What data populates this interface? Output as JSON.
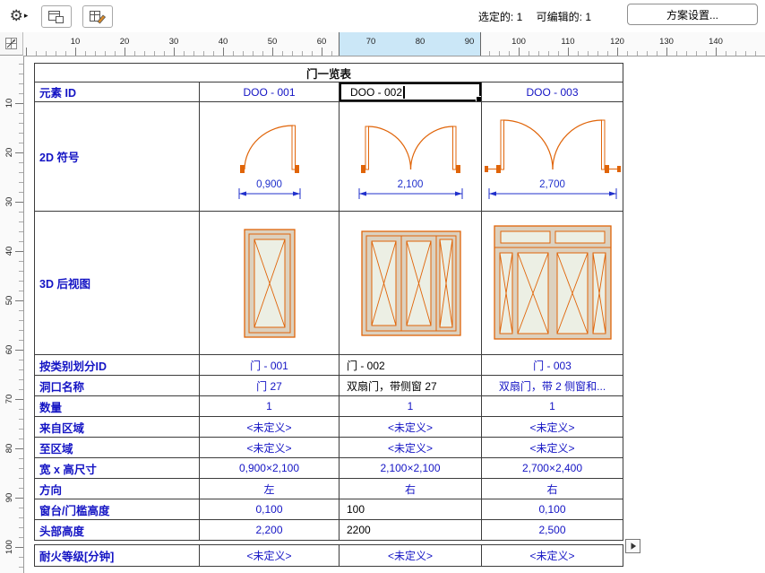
{
  "toolbar": {
    "status": {
      "selected_label": "选定的:",
      "selected_count": "1",
      "editable_label": "可编辑的:",
      "editable_count": "1"
    },
    "scheme_settings_label": "方案设置..."
  },
  "rulers": {
    "horizontal": [
      "10",
      "20",
      "30",
      "40",
      "50",
      "60",
      "70",
      "80",
      "90",
      "100",
      "110",
      "120",
      "130",
      "140"
    ],
    "vertical": [
      "10",
      "20",
      "30",
      "40",
      "50",
      "60",
      "70",
      "80",
      "90",
      "100"
    ]
  },
  "schedule": {
    "title": "门一览表",
    "element_id_row": {
      "label": "元素 ID",
      "values": [
        "DOO - 001",
        "DOO - 002",
        "DOO - 003"
      ]
    },
    "symbol_row_label": "2D 符号",
    "view_row_label": "3D 后视图",
    "dims": [
      "0,900",
      "2,100",
      "2,700"
    ],
    "rows": [
      {
        "label": "按类别划分ID",
        "values": [
          "门 - 001",
          "门 - 002",
          "门 - 003"
        ]
      },
      {
        "label": "洞口名称",
        "values": [
          "门 27",
          "双扇门，带侧窗 27",
          "双扇门，带 2 侧窗和..."
        ]
      },
      {
        "label": "数量",
        "values": [
          "1",
          "1",
          "1"
        ]
      },
      {
        "label": "来自区域",
        "values": [
          "<未定义>",
          "<未定义>",
          "<未定义>"
        ]
      },
      {
        "label": "至区域",
        "values": [
          "<未定义>",
          "<未定义>",
          "<未定义>"
        ]
      },
      {
        "label": "宽 x 高尺寸",
        "values": [
          "0,900×2,100",
          "2,100×2,100",
          "2,700×2,400"
        ]
      },
      {
        "label": "方向",
        "values": [
          "左",
          "右",
          "右"
        ]
      },
      {
        "label": "窗台/门槛高度",
        "values": [
          "0,100",
          "100",
          "0,100"
        ]
      },
      {
        "label": "头部高度",
        "values": [
          "2,200",
          "2200",
          "2,500"
        ]
      },
      {
        "label": "耐火等级[分钟]",
        "values": [
          "<未定义>",
          "<未定义>",
          "<未定义>"
        ]
      }
    ]
  }
}
